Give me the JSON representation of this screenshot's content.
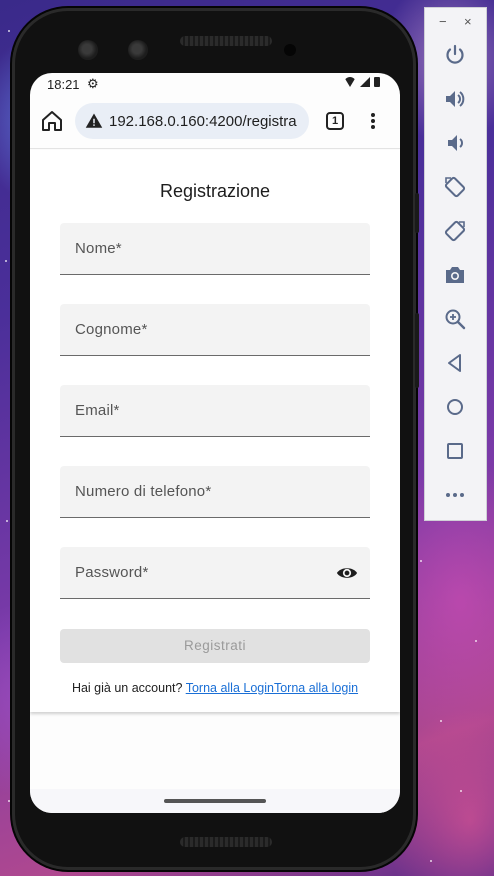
{
  "status_bar": {
    "time": "18:21"
  },
  "browser": {
    "url": "192.168.0.160:4200/registra",
    "tab_count": "1"
  },
  "form": {
    "title": "Registrazione",
    "fields": [
      {
        "label": "Nome*"
      },
      {
        "label": "Cognome*"
      },
      {
        "label": "Email*"
      },
      {
        "label": "Numero di telefono*"
      },
      {
        "label": "Password*"
      }
    ],
    "submit_label": "Registrati",
    "footer_text": "Hai già un account?",
    "login_link": "Torna alla LoginTorna alla login"
  },
  "emulator_toolbar": {
    "minimize": "−",
    "close": "×",
    "icons": [
      "power-icon",
      "volume-up-icon",
      "volume-down-icon",
      "rotate-left-icon",
      "rotate-right-icon",
      "camera-icon",
      "zoom-icon",
      "back-icon",
      "home-icon",
      "overview-icon",
      "more-icon"
    ]
  },
  "colors": {
    "link": "#1a6fd6",
    "field_bg": "#f3f3f3",
    "button_disabled": "#e1e1e1",
    "toolbar_icon": "#5a6a8a"
  }
}
